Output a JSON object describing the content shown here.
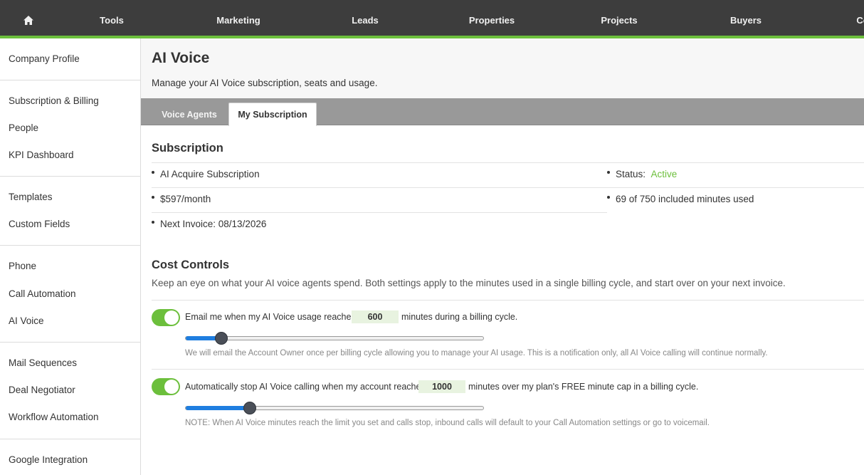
{
  "nav": {
    "items": [
      "Tools",
      "Marketing",
      "Leads",
      "Properties",
      "Projects",
      "Buyers",
      "Co"
    ],
    "accent_color": "#6cbf3c"
  },
  "sidebar": {
    "items": [
      "Company Profile",
      "Subscription & Billing",
      "People",
      "KPI Dashboard",
      "Templates",
      "Custom Fields",
      "Phone",
      "Call Automation",
      "AI Voice",
      "Mail Sequences",
      "Deal Negotiator",
      "Workflow Automation",
      "Google Integration"
    ]
  },
  "header": {
    "title": "AI Voice",
    "subtitle": "Manage your AI Voice subscription, seats and usage."
  },
  "tabs": [
    {
      "label": "Voice Agents",
      "active": false
    },
    {
      "label": "My Subscription",
      "active": true
    }
  ],
  "subscription": {
    "title": "Subscription",
    "plan": "AI Acquire Subscription",
    "price": "$597/month",
    "next_invoice": "Next Invoice: 08/13/2026",
    "status_label": "Status:",
    "status_value": "Active",
    "minutes_used": "69 of 750 included minutes used"
  },
  "cost_controls": {
    "title": "Cost Controls",
    "description": "Keep an eye on what your AI voice agents spend. Both settings apply to the minutes used in a single billing cycle, and start over on your next invoice.",
    "email_alert": {
      "enabled": true,
      "text_before": "Email me when my AI Voice usage reaches",
      "value": "600",
      "text_after": "minutes during a billing cycle.",
      "slider_fraction": 0.12,
      "note": "We will email the Account Owner once per billing cycle allowing you to manage your AI usage. This is a notification only, all AI Voice calling will continue normally."
    },
    "auto_stop": {
      "enabled": true,
      "text_before": "Automatically stop AI Voice calling when my account reaches",
      "value": "1000",
      "text_after": "minutes over my plan's FREE minute cap in a billing cycle.",
      "slider_fraction": 0.215,
      "note": "NOTE: When AI Voice minutes reach the limit you set and calls stop, inbound calls will default to your Call Automation settings or go to voicemail."
    }
  }
}
